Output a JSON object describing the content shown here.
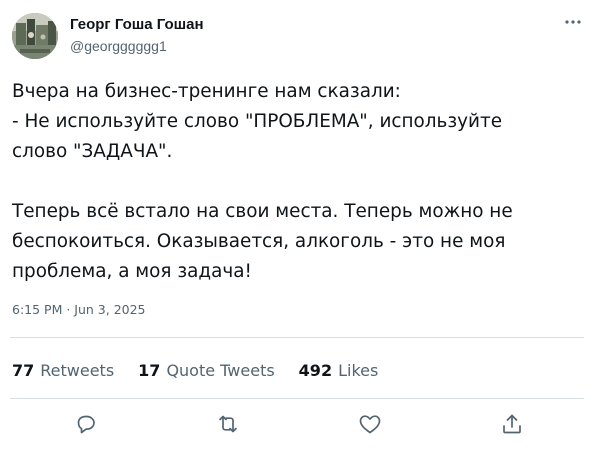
{
  "author": {
    "display_name": "Георг Гоша Гошан",
    "handle": "@georgggggg1"
  },
  "tweet": {
    "lines_paragraph_1": [
      "Вчера на бизнес-тренинге нам сказали:",
      "- Не используйте слово \"ПРОБЛЕМА\", используйте",
      "слово \"ЗАДАЧА\"."
    ],
    "lines_paragraph_2": [
      "Теперь всё встало на свои места. Теперь можно не",
      "беспокоиться. Оказывается, алкоголь - это не моя",
      "проблема, а моя задача!"
    ],
    "timestamp": "6:15 PM · Jun 3, 2025"
  },
  "stats": {
    "retweets": {
      "count": "77",
      "label": "Retweets"
    },
    "quote_tweets": {
      "count": "17",
      "label": "Quote Tweets"
    },
    "likes": {
      "count": "492",
      "label": "Likes"
    }
  },
  "icons": {
    "more": "more-dots-icon",
    "reply": "reply-icon",
    "retweet": "retweet-icon",
    "like": "heart-icon",
    "share": "share-icon"
  },
  "colors": {
    "text_primary": "#0f1419",
    "text_secondary": "#536471",
    "divider": "#d8dfe4",
    "icon": "#536471"
  }
}
